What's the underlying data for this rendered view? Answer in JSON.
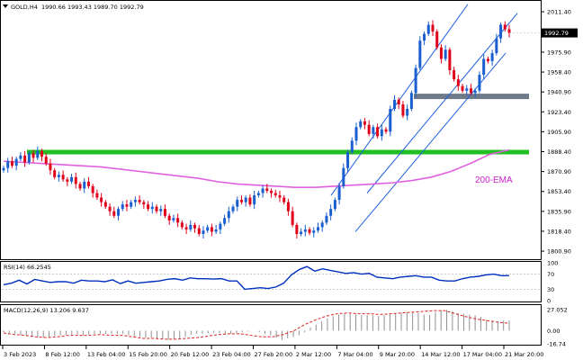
{
  "header": {
    "symbol": "GOLD,H4",
    "ohlc": "1990.66 1993.43 1989.70 1992.79"
  },
  "colors": {
    "up_candle": "#1a5fd0",
    "down_candle": "#e0001a",
    "ema": "#e060e0",
    "channel": "#2060e0",
    "support_band": "#20c020",
    "resistance_band": "#707b8a",
    "rsi_line": "#0030c0",
    "macd_hist": "#909090",
    "macd_signal": "#e02020"
  },
  "chart_data": [
    {
      "type": "candlestick",
      "panel": "price",
      "ylim": [
        1797,
        2017
      ],
      "yticks": [
        "2011.40",
        "1993.45",
        "1975.90",
        "1958.40",
        "1940.90",
        "1923.40",
        "1905.90",
        "1888.40",
        "1870.90",
        "1853.40",
        "1835.90",
        "1818.40",
        "1800.90"
      ],
      "ytick_values": [
        2011.4,
        1993.45,
        1975.9,
        1958.4,
        1940.9,
        1923.4,
        1905.9,
        1888.4,
        1870.9,
        1853.4,
        1835.9,
        1818.4,
        1800.9
      ],
      "last_price_label": "1992.79",
      "last_price": 1992.79,
      "close_series": [
        1874,
        1880,
        1876,
        1882,
        1885,
        1879,
        1887,
        1883,
        1889,
        1884,
        1878,
        1872,
        1866,
        1868,
        1864,
        1862,
        1866,
        1860,
        1856,
        1862,
        1858,
        1852,
        1848,
        1844,
        1840,
        1836,
        1832,
        1838,
        1842,
        1840,
        1844,
        1846,
        1844,
        1842,
        1838,
        1840,
        1836,
        1838,
        1832,
        1828,
        1830,
        1826,
        1822,
        1820,
        1824,
        1821,
        1816,
        1819,
        1822,
        1818,
        1820,
        1825,
        1830,
        1836,
        1840,
        1846,
        1844,
        1848,
        1842,
        1850,
        1852,
        1856,
        1854,
        1852,
        1850,
        1848,
        1844,
        1836,
        1824,
        1816,
        1818,
        1820,
        1817,
        1819,
        1822,
        1826,
        1832,
        1838,
        1846,
        1858,
        1874,
        1888,
        1898,
        1910,
        1915,
        1912,
        1904,
        1910,
        1902,
        1908,
        1906,
        1926,
        1934,
        1930,
        1920,
        1926,
        1940,
        1962,
        1986,
        1992,
        2000,
        1994,
        1980,
        1970,
        1978,
        1960,
        1952,
        1946,
        1942,
        1944,
        1940,
        1942,
        1956,
        1970,
        1968,
        1975,
        1988,
        2000,
        1996,
        1992.79
      ],
      "ema": {
        "name": "200-EMA",
        "values": [
          1880,
          1879,
          1878,
          1877,
          1876,
          1875,
          1873,
          1871,
          1869,
          1867,
          1865,
          1862,
          1860,
          1859,
          1858,
          1857,
          1857,
          1858,
          1859,
          1860,
          1861,
          1863,
          1866,
          1871,
          1878,
          1886,
          1890
        ]
      },
      "channel": {
        "lower": [
          [
            1840,
            1818
          ],
          [
            2072,
            1975
          ]
        ],
        "upper": [
          [
            1832,
            1850
          ],
          [
            2064,
            2018
          ]
        ]
      },
      "horizontal_levels": [
        {
          "name": "support",
          "value": 1888
        },
        {
          "name": "resistance",
          "value": 1937
        }
      ]
    },
    {
      "type": "line",
      "panel": "indicator",
      "title": "RSI(14) 66.2545",
      "ylim": [
        0,
        100
      ],
      "yticks": [
        "100",
        "70",
        "30",
        "0"
      ],
      "levels": [
        70,
        30
      ],
      "values": [
        42,
        46,
        54,
        44,
        56,
        52,
        48,
        50,
        50,
        46,
        54,
        52,
        52,
        50,
        55,
        45,
        52,
        46,
        48,
        50,
        52,
        56,
        58,
        54,
        60,
        58,
        58,
        57,
        58,
        52,
        52,
        30,
        32,
        34,
        32,
        36,
        46,
        68,
        82,
        90,
        78,
        84,
        80,
        76,
        72,
        74,
        70,
        72,
        62,
        60,
        58,
        62,
        64,
        66,
        62,
        62,
        54,
        52,
        52,
        58,
        62,
        64,
        68,
        70,
        66,
        66.25
      ]
    },
    {
      "type": "bar",
      "panel": "indicator",
      "title": "MACD(12,26,9) 13.206 9.637",
      "ylim": [
        -17,
        32
      ],
      "yticks": [
        "27.052",
        "0.00",
        "-16.74"
      ],
      "histogram": [
        -2,
        -3,
        -4,
        -6,
        -6,
        -8,
        -8,
        -9,
        -8,
        -7,
        -6,
        -5,
        -5,
        -5,
        -6,
        -5,
        -4,
        -4,
        -4,
        -4,
        -4,
        -4,
        -6,
        -8,
        -8,
        -9,
        -9,
        -10,
        -11,
        -12,
        -11,
        -10,
        -8,
        -5,
        -4,
        -4,
        -3,
        -3,
        -3,
        -4,
        -4,
        -3,
        -2,
        -1,
        0,
        -2,
        -4,
        -6,
        -9,
        -12,
        -10,
        -8,
        -6,
        -2,
        4,
        8,
        12,
        16,
        19,
        21,
        22,
        22,
        21,
        20,
        20,
        20,
        19,
        20,
        21,
        22,
        23,
        24,
        24,
        23,
        21,
        20,
        24,
        26,
        27,
        25,
        23,
        22,
        21,
        20,
        18,
        14,
        12,
        12,
        13,
        13
      ],
      "signal": [
        -3,
        -5,
        -6,
        -8,
        -9,
        -8,
        -6,
        -6,
        -6,
        -5,
        -6,
        -6,
        -8,
        -10,
        -10,
        -11,
        -11,
        -10,
        -9,
        -7,
        -5,
        -4,
        -4,
        -6,
        -8,
        -8,
        -5,
        0,
        8,
        14,
        19,
        22,
        23,
        22,
        22,
        21,
        22,
        23,
        24,
        25,
        26,
        26,
        22,
        18,
        15,
        13,
        11,
        9.6
      ]
    }
  ],
  "xaxis": {
    "ticks": [
      "3 Feb 2023",
      "8 Feb 12:00",
      "13 Feb 04:00",
      "15 Feb 20:00",
      "20 Feb 12:00",
      "23 Feb 04:00",
      "27 Feb 20:00",
      "2 Mar 12:00",
      "7 Mar 04:00",
      "9 Mar 20:00",
      "14 Mar 12:00",
      "17 Mar 04:00",
      "21 Mar 20:00"
    ]
  },
  "rsi_axis": {
    "labels": [
      "100",
      "70",
      "30",
      "0"
    ]
  }
}
